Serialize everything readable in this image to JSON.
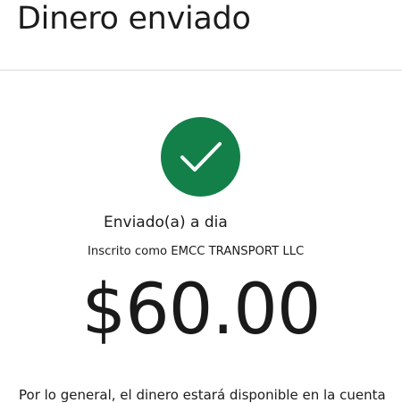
{
  "header": {
    "title": "Dinero enviado"
  },
  "confirmation": {
    "icon": "checkmark-icon",
    "accent_color": "#138049",
    "status_text": "Enviado(a) a dia",
    "enrolled_text": "Inscrito como EMCC TRANSPORT LLC",
    "amount": "$60.00",
    "footnote": "Por lo general, el dinero estará disponible en la cuenta"
  }
}
